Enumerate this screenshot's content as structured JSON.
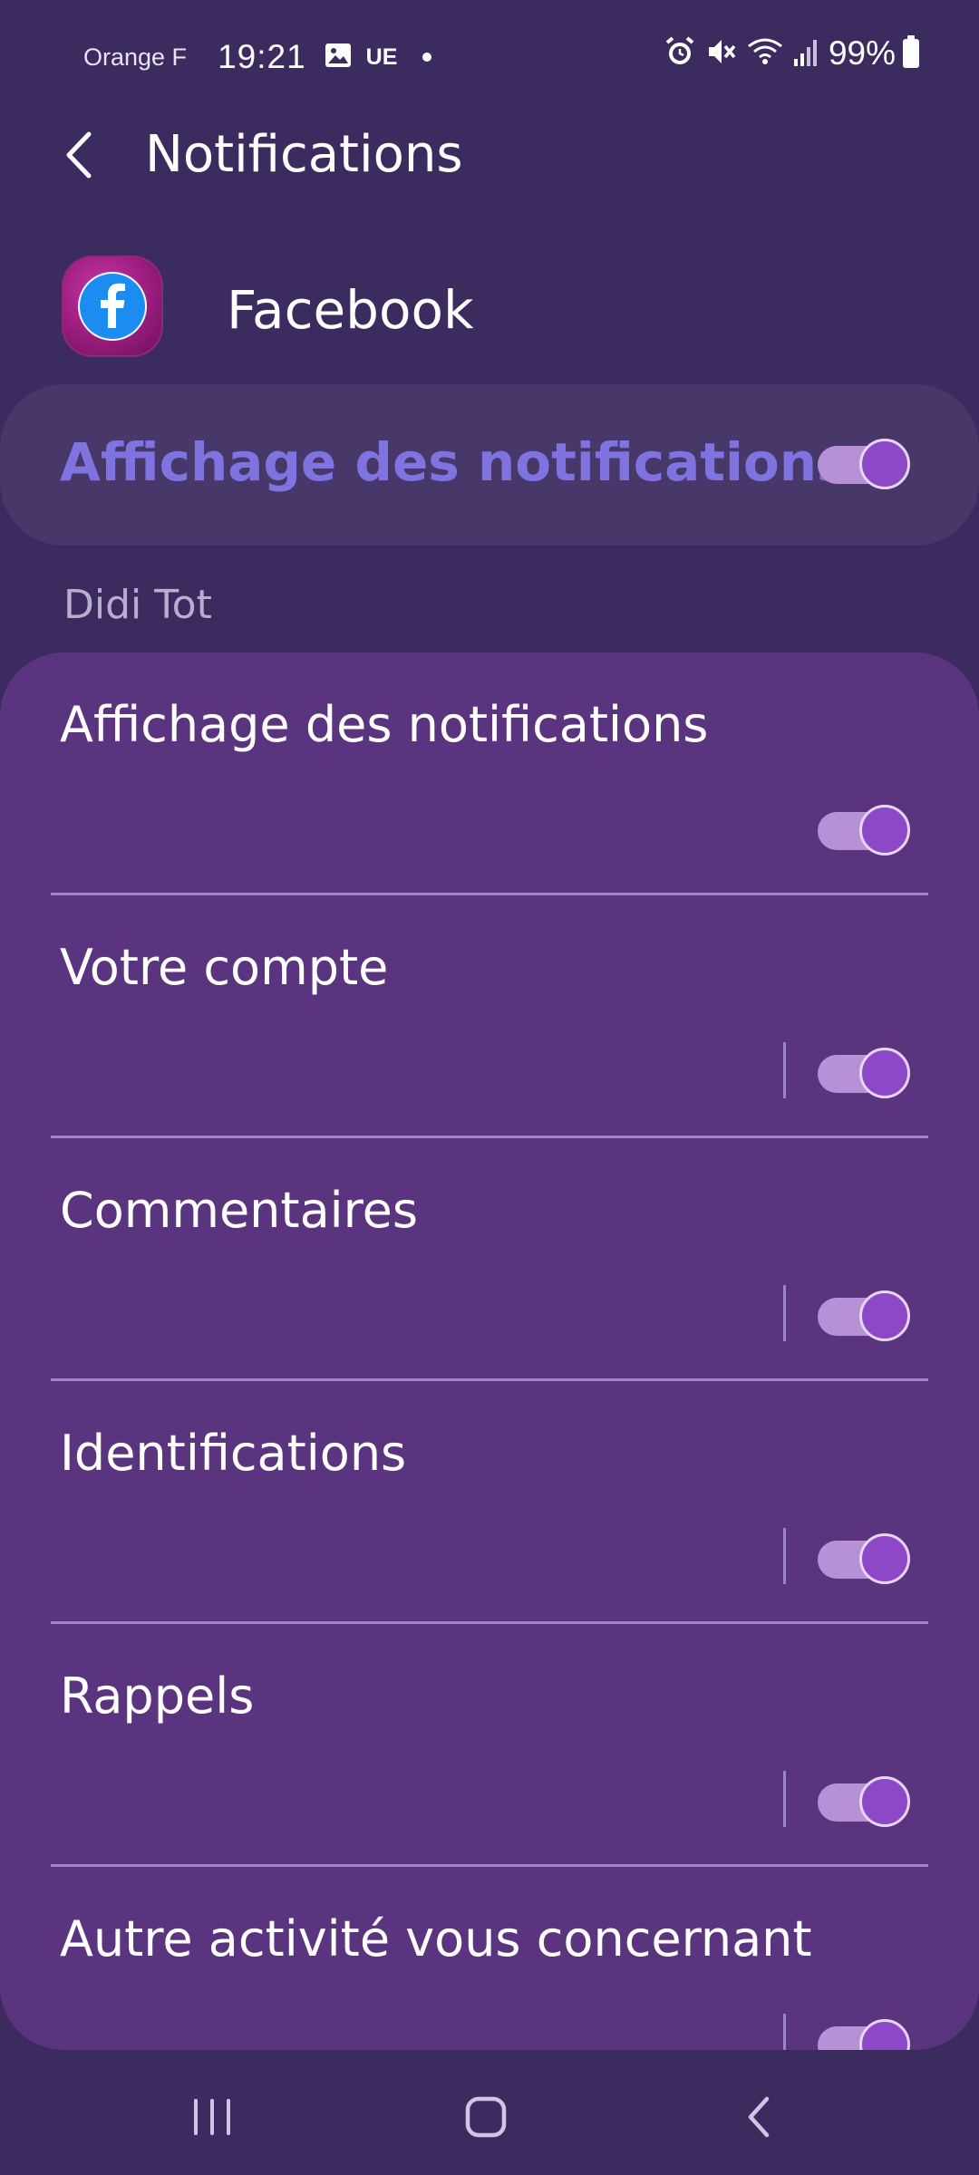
{
  "status_bar": {
    "carrier": "Orange F",
    "time": "19:21",
    "network_tag": "UE",
    "battery": "99%"
  },
  "app_bar": {
    "title": "Notifications"
  },
  "app": {
    "name": "Facebook",
    "icon": "facebook-icon"
  },
  "master_toggle": {
    "label": "Affichage des notifications",
    "enabled": true
  },
  "section": {
    "title": "Didi Tot"
  },
  "categories": [
    {
      "label": "Affichage des notifications",
      "enabled": true
    },
    {
      "label": "Votre compte",
      "enabled": true
    },
    {
      "label": "Commentaires",
      "enabled": true
    },
    {
      "label": "Identifications",
      "enabled": true
    },
    {
      "label": "Rappels",
      "enabled": true
    },
    {
      "label": "Autre activité vous concernant",
      "enabled": true
    }
  ],
  "colors": {
    "background": "#3b2b5f",
    "card": "#5a347f",
    "master_card": "#473869",
    "accent_text": "#7f73e0",
    "toggle_thumb": "#8d48c8",
    "toggle_track": "#b791d6"
  }
}
